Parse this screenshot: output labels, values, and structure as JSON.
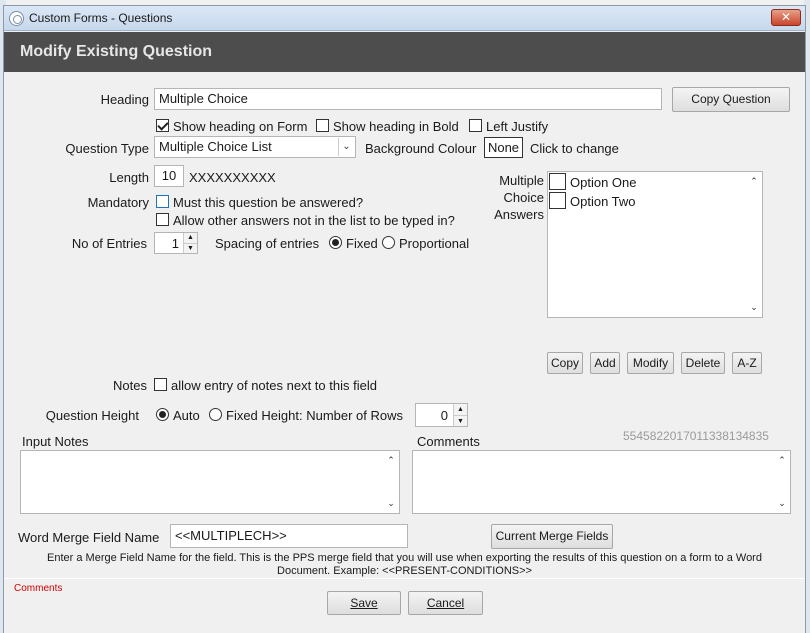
{
  "window": {
    "title": "Custom Forms - Questions",
    "close_glyph": "✕"
  },
  "header": {
    "title": "Modify Existing Question"
  },
  "heading": {
    "label": "Heading",
    "value": "Multiple Choice",
    "copy_button": "Copy Question",
    "show_on_form": "Show heading on Form",
    "show_bold": "Show heading in Bold",
    "left_justify": "Left Justify"
  },
  "question_type": {
    "label": "Question Type",
    "value": "Multiple Choice List",
    "bg_label": "Background Colour",
    "bg_value": "None",
    "bg_hint": "Click to change"
  },
  "length": {
    "label": "Length",
    "value": "10",
    "mask": "XXXXXXXXXX"
  },
  "mandatory": {
    "label": "Mandatory",
    "must_answer": "Must this question be answered?",
    "allow_other": "Allow other answers not in the list to be typed in?"
  },
  "entries": {
    "label": "No of Entries",
    "value": "1",
    "spacing_label": "Spacing of entries",
    "fixed": "Fixed",
    "proportional": "Proportional"
  },
  "mc_answers": {
    "label_line1": "Multiple",
    "label_line2": "Choice",
    "label_line3": "Answers",
    "options": [
      "Option One",
      "Option Two"
    ]
  },
  "answer_buttons": {
    "copy": "Copy",
    "add": "Add",
    "modify": "Modify",
    "delete": "Delete",
    "az": "A-Z"
  },
  "notes": {
    "label": "Notes",
    "allow": "allow entry of notes next to this field"
  },
  "question_height": {
    "label": "Question Height",
    "auto": "Auto",
    "fixed": "Fixed Height: Number of Rows",
    "rows": "0"
  },
  "id_number": "5545822017011338134835",
  "input_notes": {
    "label": "Input Notes"
  },
  "comments": {
    "label": "Comments"
  },
  "merge": {
    "label": "Word Merge Field Name",
    "value": "<<MULTIPLECH>>",
    "button": "Current Merge Fields",
    "help_line1": "Enter a Merge Field Name for the field. This is the PPS merge field that you will use when exporting the results of this question on a form to a Word",
    "help_line2": "Document. Example: <<PRESENT-CONDITIONS>>"
  },
  "footer": {
    "comments_link": "Comments",
    "save": "Save",
    "cancel": "Cancel"
  },
  "colors": {
    "header_band": "#4d4d4d",
    "comments_link": "#d40000",
    "id_number": "#9a9a9a"
  }
}
